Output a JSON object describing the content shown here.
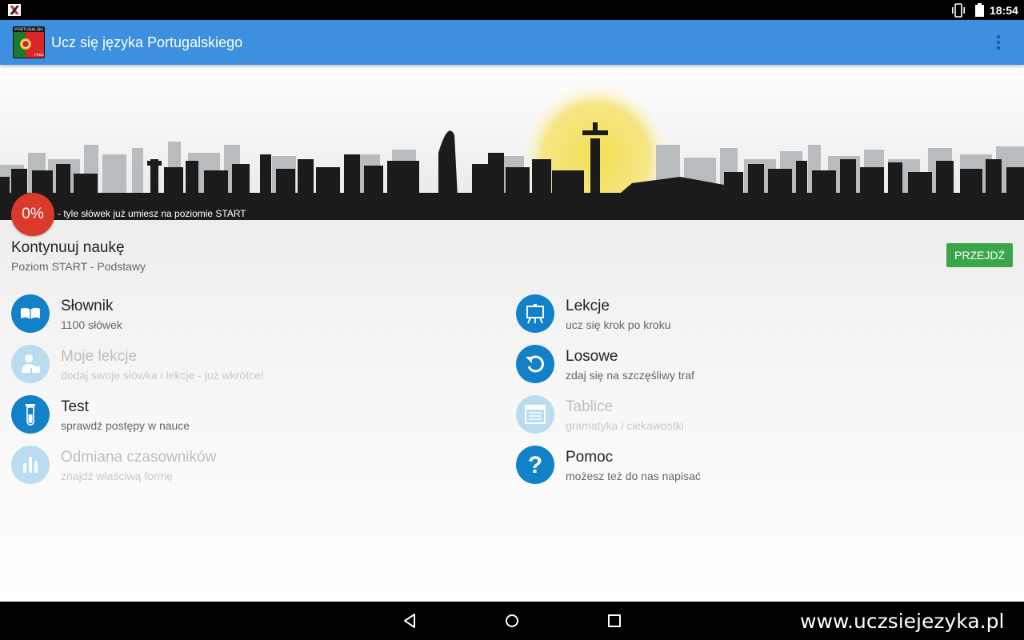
{
  "status_bar": {
    "time": "18:54"
  },
  "app_bar": {
    "title": "Ucz się języka Portugalskiego",
    "logo_label": "PORTUGALSKI",
    "logo_badge": "FREE"
  },
  "banner": {
    "progress_value": "0%",
    "progress_text": "- tyle słówek już umiesz na poziomie START"
  },
  "continue": {
    "title": "Kontynuuj naukę",
    "subtitle": "Poziom START - Podstawy",
    "button": "PRZEJDŹ"
  },
  "menu": {
    "left": [
      {
        "title": "Słownik",
        "subtitle": "1100 słówek",
        "icon": "book-icon",
        "enabled": true
      },
      {
        "title": "Moje lekcje",
        "subtitle": "dodaj swoje słówka i lekcje - już wkrótce!",
        "icon": "teacher-icon",
        "enabled": false
      },
      {
        "title": "Test",
        "subtitle": "sprawdź postępy w nauce",
        "icon": "test-tube-icon",
        "enabled": true
      },
      {
        "title": "Odmiana czasowników",
        "subtitle": "znajdź właściwą formę",
        "icon": "bars-icon",
        "enabled": false
      }
    ],
    "right": [
      {
        "title": "Lekcje",
        "subtitle": "ucz się krok po kroku",
        "icon": "easel-icon",
        "enabled": true
      },
      {
        "title": "Losowe",
        "subtitle": "zdaj się na szczęśliwy traf",
        "icon": "refresh-icon",
        "enabled": true
      },
      {
        "title": "Tablice",
        "subtitle": "gramatyka i ciekawostki",
        "icon": "table-icon",
        "enabled": false
      },
      {
        "title": "Pomoc",
        "subtitle": "możesz też do nas napisać",
        "icon": "question-icon",
        "enabled": true
      }
    ]
  },
  "footer": {
    "website": "www.uczsiejezyka.pl"
  },
  "colors": {
    "app_bar": "#3d8fe0",
    "accent_blue": "#1281c8",
    "go_button": "#3aa64a",
    "progress_red": "#d93a2b"
  }
}
